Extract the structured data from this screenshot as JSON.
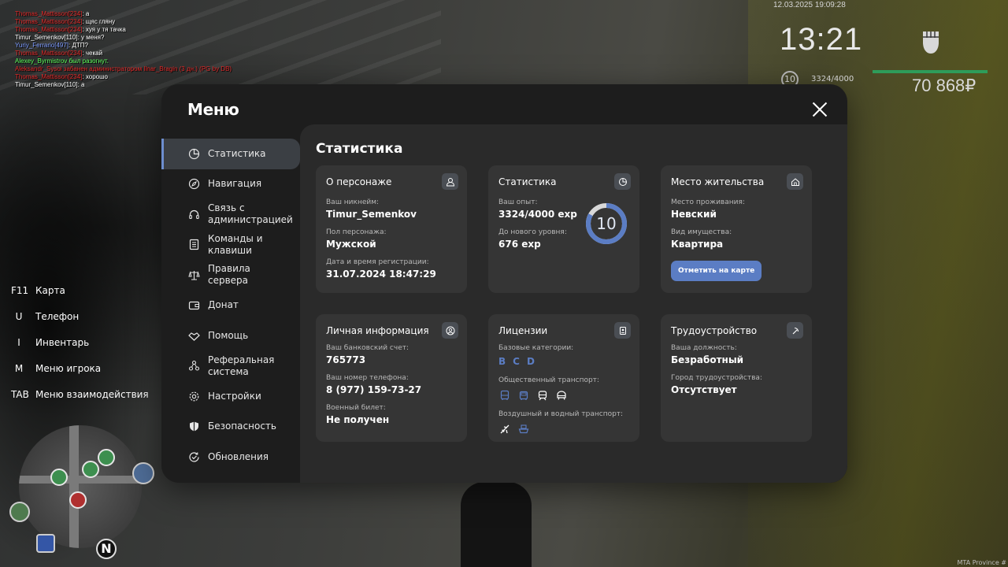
{
  "chat": [
    {
      "name": "Thomas_Mattisson[234]",
      "name_color": "red",
      "text": "а",
      "text_color": "white"
    },
    {
      "name": "Thomas_Mattisson[234]",
      "name_color": "red",
      "text": "щяс гляну",
      "text_color": "white"
    },
    {
      "name": "Thomas_Mattisson[234]",
      "name_color": "red",
      "text": "хуя у тя тачка",
      "text_color": "white"
    },
    {
      "name": "Timur_Semenkov[110]",
      "name_color": "white",
      "text": "у меня?",
      "text_color": "white"
    },
    {
      "name": "Yuriy_Ferrario[497]",
      "name_color": "blue",
      "text": "ДТП?",
      "text_color": "white"
    },
    {
      "name": "Thomas_Mattisson[234]",
      "name_color": "red",
      "text": "чекай",
      "text_color": "white"
    },
    {
      "name": "Alexey_Byrmistrov был разогнут.",
      "name_color": "green",
      "text": "",
      "text_color": "white"
    },
    {
      "name": "Aleksandr_Sysoi забанен администратором Ilnar_Bragin (3 дн.) (PG by DB)",
      "name_color": "red",
      "text": "",
      "text_color": "red"
    },
    {
      "name": "Thomas_Mattisson[234]",
      "name_color": "red",
      "text": "хорошо",
      "text_color": "white"
    },
    {
      "name": "Timur_Semenkov[110]",
      "name_color": "white",
      "text": "а",
      "text_color": "white"
    }
  ],
  "hud": {
    "datetime": "12.03.2025 19:09:28",
    "clock": "13:21",
    "level": "10",
    "exp": "3324/4000",
    "money": "70 868₽",
    "health_fraction": 1.0,
    "watermark": "MTA Province #"
  },
  "keybinds": [
    {
      "key": "F11",
      "action": "Карта"
    },
    {
      "key": "U",
      "action": "Телефон"
    },
    {
      "key": "I",
      "action": "Инвентарь"
    },
    {
      "key": "M",
      "action": "Меню игрока"
    },
    {
      "key": "TAB",
      "action": "Меню взаимодействия"
    }
  ],
  "minimap": {
    "north": "N"
  },
  "menu": {
    "title": "Меню",
    "nav": [
      {
        "label": "Статистика",
        "icon": "pie-chart-icon",
        "active": true
      },
      {
        "label": "Навигация",
        "icon": "compass-icon",
        "active": false
      },
      {
        "label": "Связь с администрацией",
        "icon": "headset-icon",
        "active": false
      },
      {
        "label": "Команды и клавиши",
        "icon": "document-icon",
        "active": false
      },
      {
        "label": "Правила сервера",
        "icon": "scales-icon",
        "active": false
      },
      {
        "label": "Донат",
        "icon": "wallet-icon",
        "active": false
      },
      {
        "label": "Помощь",
        "icon": "handshake-icon",
        "active": false
      },
      {
        "label": "Реферальная система",
        "icon": "network-icon",
        "active": false
      },
      {
        "label": "Настройки",
        "icon": "gear-icon",
        "active": false
      },
      {
        "label": "Безопасность",
        "icon": "shield-icon",
        "active": false
      },
      {
        "label": "Обновления",
        "icon": "refresh-check-icon",
        "active": false
      }
    ],
    "content_title": "Статистика",
    "cards": {
      "character": {
        "title": "О персонаже",
        "icon": "user-icon",
        "nickname_label": "Ваш никнейм:",
        "nickname": "Timur_Semenkov",
        "gender_label": "Пол персонажа:",
        "gender": "Мужской",
        "reg_label": "Дата и время регистрации:",
        "reg": "31.07.2024 18:47:29"
      },
      "stats": {
        "title": "Статистика",
        "icon": "pie-chart-icon",
        "exp_label": "Ваш опыт:",
        "exp": "3324/4000 exp",
        "next_label": "До нового уровня:",
        "next": "676 exp",
        "level": "10",
        "level_progress": 0.831
      },
      "residence": {
        "title": "Место жительства",
        "icon": "home-icon",
        "place_label": "Место проживания:",
        "place": "Невский",
        "property_label": "Вид имущества:",
        "property": "Квартира",
        "button": "Отметить на карте"
      },
      "personal": {
        "title": "Личная информация",
        "icon": "user-circle-icon",
        "bank_label": "Ваш банковский счет:",
        "bank": "765773",
        "phone_label": "Ваш номер телефона:",
        "phone": "8 (977) 159-73-27",
        "military_label": "Военный билет:",
        "military": "Не получен"
      },
      "licenses": {
        "title": "Лицензии",
        "icon": "id-card-icon",
        "base_label": "Базовые категории:",
        "base": [
          "B",
          "C",
          "D"
        ],
        "public_label": "Общественный транспорт:",
        "public_icons": [
          {
            "name": "bus-icon",
            "owned": false
          },
          {
            "name": "trolleybus-icon",
            "owned": false
          },
          {
            "name": "tram-icon",
            "owned": true
          },
          {
            "name": "metro-icon",
            "owned": true
          }
        ],
        "air_label": "Воздушный и водный транспорт:",
        "air_icons": [
          {
            "name": "plane-icon",
            "owned": true
          },
          {
            "name": "boat-icon",
            "owned": false
          }
        ]
      },
      "job": {
        "title": "Трудоустройство",
        "icon": "pickaxe-icon",
        "position_label": "Ваша должность:",
        "position": "Безработный",
        "city_label": "Город трудоустройства:",
        "city": "Отсутствует"
      }
    }
  }
}
